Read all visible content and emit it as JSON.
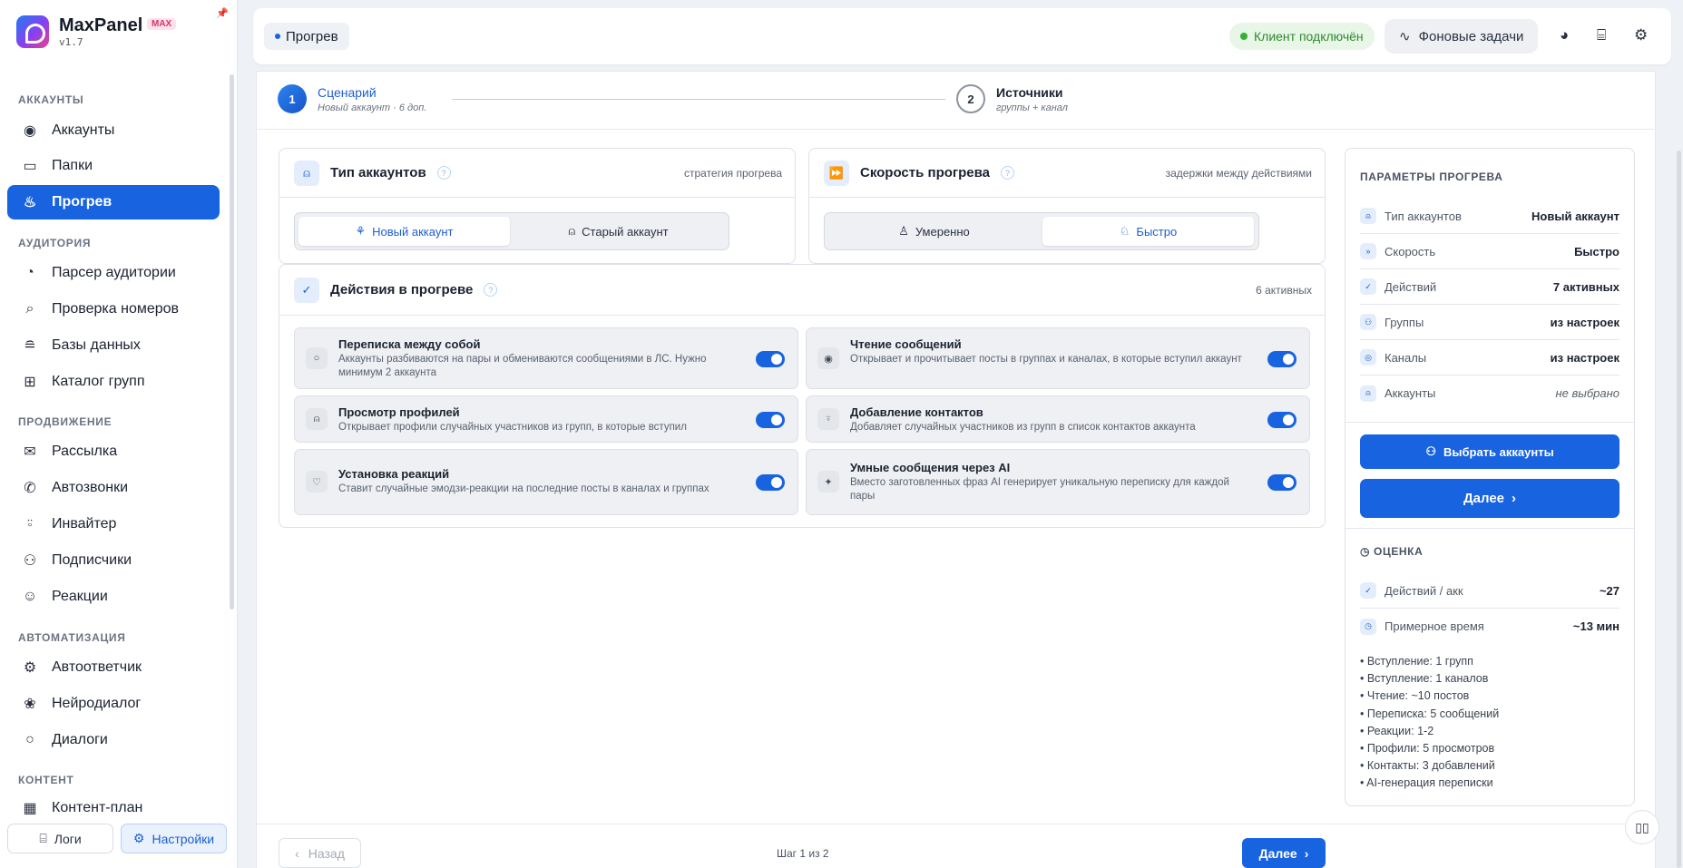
{
  "app": {
    "name": "MaxPanel",
    "badge": "MAX",
    "version": "v1.7",
    "accent": "#1763e0"
  },
  "sidebar": {
    "sections": [
      {
        "title": "АККАУНТЫ",
        "items": [
          {
            "label": "Аккаунты",
            "icon": "user-circle-icon"
          },
          {
            "label": "Папки",
            "icon": "folder-icon"
          },
          {
            "label": "Прогрев",
            "icon": "flame-icon",
            "active": true
          }
        ]
      },
      {
        "title": "АУДИТОРИЯ",
        "items": [
          {
            "label": "Парсер аудитории",
            "icon": "gauge-icon"
          },
          {
            "label": "Проверка номеров",
            "icon": "phone-search-icon"
          },
          {
            "label": "Базы данных",
            "icon": "database-icon"
          },
          {
            "label": "Каталог групп",
            "icon": "grid-icon"
          }
        ]
      },
      {
        "title": "ПРОДВИЖЕНИЕ",
        "items": [
          {
            "label": "Рассылка",
            "icon": "mail-icon"
          },
          {
            "label": "Автозвонки",
            "icon": "phone-icon"
          },
          {
            "label": "Инвайтер",
            "icon": "user-plus-icon"
          },
          {
            "label": "Подписчики",
            "icon": "users-icon"
          },
          {
            "label": "Реакции",
            "icon": "smile-icon"
          }
        ]
      },
      {
        "title": "АВТОМАТИЗАЦИЯ",
        "items": [
          {
            "label": "Автоответчик",
            "icon": "bot-icon"
          },
          {
            "label": "Нейродиалог",
            "icon": "brain-icon"
          },
          {
            "label": "Диалоги",
            "icon": "chat-icon"
          }
        ]
      },
      {
        "title": "КОНТЕНТ",
        "items": [
          {
            "label": "Контент-план",
            "icon": "calendar-icon"
          }
        ]
      }
    ],
    "bottom": {
      "logs": "Логи",
      "settings": "Настройки"
    }
  },
  "header": {
    "breadcrumb": "Прогрев",
    "client_status": "Клиент подключён",
    "background_tasks": "Фоновые задачи"
  },
  "stepper": [
    {
      "num": "1",
      "title": "Сценарий",
      "sub": "Новый аккаунт · 6 доп."
    },
    {
      "num": "2",
      "title": "Источники",
      "sub": "группы + канал"
    }
  ],
  "account_type": {
    "title": "Тип аккаунтов",
    "hint": "стратегия прогрева",
    "options": [
      "Новый аккаунт",
      "Старый аккаунт"
    ],
    "selected": "Новый аккаунт"
  },
  "speed": {
    "title": "Скорость прогрева",
    "hint": "задержки между действиями",
    "options": [
      "Умеренно",
      "Быстро"
    ],
    "selected": "Быстро"
  },
  "actions": {
    "title": "Действия в прогреве",
    "count": "6 активных",
    "items": [
      {
        "title": "Переписка между собой",
        "desc": "Аккаунты разбиваются на пары и обмениваются сообщениями в ЛС. Нужно минимум 2 аккаунта",
        "enabled": true
      },
      {
        "title": "Чтение сообщений",
        "desc": "Открывает и прочитывает посты в группах и каналах, в которые вступил аккаунт",
        "enabled": true
      },
      {
        "title": "Просмотр профилей",
        "desc": "Открывает профили случайных участников из групп, в которые вступил",
        "enabled": true
      },
      {
        "title": "Добавление контактов",
        "desc": "Добавляет случайных участников из групп в список контактов аккаунта",
        "enabled": true
      },
      {
        "title": "Установка реакций",
        "desc": "Ставит случайные эмодзи-реакции на последние посты в каналах и группах",
        "enabled": true
      },
      {
        "title": "Умные сообщения через AI",
        "desc": "Вместо заготовленных фраз AI генерирует уникальную переписку для каждой пары",
        "enabled": true
      }
    ]
  },
  "params": {
    "title": "ПАРАМЕТРЫ ПРОГРЕВА",
    "rows": [
      {
        "label": "Тип аккаунтов",
        "value": "Новый аккаунт"
      },
      {
        "label": "Скорость",
        "value": "Быстро"
      },
      {
        "label": "Действий",
        "value": "7 активных"
      },
      {
        "label": "Группы",
        "value": "из настроек"
      },
      {
        "label": "Каналы",
        "value": "из настроек"
      },
      {
        "label": "Аккаунты",
        "value": "не выбрано"
      }
    ],
    "select_accounts": "Выбрать аккаунты",
    "next": "Далее"
  },
  "estimate": {
    "title": "ОЦЕНКА",
    "rows": [
      {
        "label": "Действий / акк",
        "value": "~27"
      },
      {
        "label": "Примерное время",
        "value": "~13 мин"
      }
    ],
    "bullets": [
      "• Вступление: 1 групп",
      "• Вступление: 1 каналов",
      "• Чтение: ~10 постов",
      "• Переписка: 5 сообщений",
      "• Реакции: 1-2",
      "• Профили: 5 просмотров",
      "• Контакты: 3 добавлений",
      "• AI-генерация переписки"
    ]
  },
  "footer": {
    "back": "Назад",
    "step": "Шаг 1 из 2",
    "next": "Далее"
  }
}
